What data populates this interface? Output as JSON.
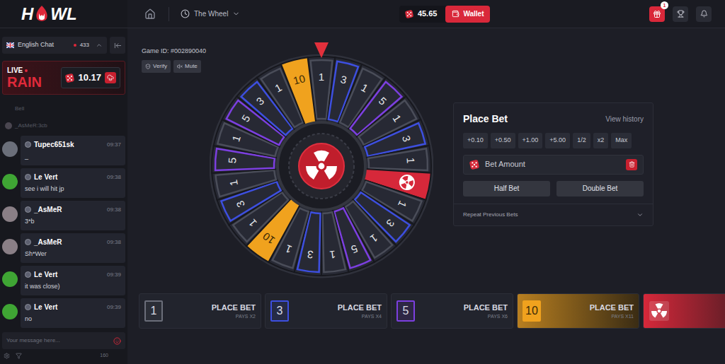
{
  "header": {
    "logo": {
      "left": "H",
      "right": "WL"
    },
    "game_menu": "The Wheel",
    "balance": "45.65",
    "wallet_button": "Wallet",
    "gift_badge": "1"
  },
  "chat": {
    "room": "English Chat",
    "online": "433",
    "rain": {
      "live": "LIVE",
      "title": "RAIN",
      "amount": "10.17"
    },
    "faded": [
      "Bell",
      "_AsMeR:3cb"
    ],
    "messages": [
      {
        "user": "Tupec651sk",
        "time": "09:37",
        "text": "_",
        "color": "#6b6f7a"
      },
      {
        "user": "Le Vert",
        "time": "09:38",
        "text": "see i will hit jp",
        "color": "#3fa534"
      },
      {
        "user": "_AsMeR",
        "time": "09:38",
        "text": "3*b",
        "color": "#8a7f86"
      },
      {
        "user": "_AsMeR",
        "time": "09:38",
        "text": "Sh*Wer",
        "color": "#8a7f86"
      },
      {
        "user": "Le Vert",
        "time": "09:39",
        "text": "it was close)",
        "color": "#3fa534"
      },
      {
        "user": "Le Vert",
        "time": "09:39",
        "text": "no",
        "color": "#3fa534"
      }
    ],
    "input_placeholder": "Your message here...",
    "footer_count": "160"
  },
  "game": {
    "id_label": "Game ID: #002890040",
    "buttons": [
      "Verify",
      "Mute"
    ],
    "segments": [
      {
        "label": "1",
        "kind": "outline",
        "color": "#4a4d59"
      },
      {
        "label": "3",
        "kind": "outline",
        "color": "#3d4fe0"
      },
      {
        "label": "1",
        "kind": "outline",
        "color": "#4a4d59"
      },
      {
        "label": "5",
        "kind": "outline",
        "color": "#7c3fe0"
      },
      {
        "label": "1",
        "kind": "outline",
        "color": "#4a4d59"
      },
      {
        "label": "3",
        "kind": "outline",
        "color": "#3d4fe0"
      },
      {
        "label": "1",
        "kind": "outline",
        "color": "#4a4d59"
      },
      {
        "kind": "jackpot",
        "color": "#d6283a"
      },
      {
        "label": "1",
        "kind": "outline",
        "color": "#4a4d59"
      },
      {
        "label": "3",
        "kind": "outline",
        "color": "#3d4fe0"
      },
      {
        "label": "1",
        "kind": "outline",
        "color": "#4a4d59"
      },
      {
        "label": "5",
        "kind": "outline",
        "color": "#7c3fe0"
      },
      {
        "label": "1",
        "kind": "outline",
        "color": "#4a4d59"
      },
      {
        "label": "3",
        "kind": "outline",
        "color": "#3d4fe0"
      },
      {
        "label": "1",
        "kind": "outline",
        "color": "#4a4d59"
      },
      {
        "label": "10",
        "kind": "solid",
        "color": "#f0a21e"
      },
      {
        "label": "1",
        "kind": "outline",
        "color": "#4a4d59"
      },
      {
        "label": "3",
        "kind": "outline",
        "color": "#3d4fe0"
      },
      {
        "label": "1",
        "kind": "outline",
        "color": "#4a4d59"
      },
      {
        "label": "5",
        "kind": "outline",
        "color": "#7c3fe0"
      },
      {
        "label": "1",
        "kind": "outline",
        "color": "#4a4d59"
      },
      {
        "label": "5",
        "kind": "outline",
        "color": "#7c3fe0"
      },
      {
        "label": "3",
        "kind": "outline",
        "color": "#3d4fe0"
      },
      {
        "label": "1",
        "kind": "outline",
        "color": "#4a4d59"
      },
      {
        "label": "10",
        "kind": "solid",
        "color": "#f0a21e"
      }
    ]
  },
  "bet_panel": {
    "title": "Place Bet",
    "history_link": "View history",
    "quick_amounts": [
      "+0.10",
      "+0.50",
      "+1.00",
      "+5.00",
      "1/2",
      "x2",
      "Max"
    ],
    "amount_placeholder": "Bet Amount",
    "half_button": "Half Bet",
    "double_button": "Double Bet",
    "repeat_label": "Repeat Previous Bets"
  },
  "bet_options": [
    {
      "label": "1",
      "action": "PLACE BET",
      "payout": "PAYS X2",
      "kind": "outline",
      "color": "#6b6e7a"
    },
    {
      "label": "3",
      "action": "PLACE BET",
      "payout": "PAYS X4",
      "kind": "outline",
      "color": "#3d4fe0"
    },
    {
      "label": "5",
      "action": "PLACE BET",
      "payout": "PAYS X6",
      "kind": "outline",
      "color": "#7c3fe0"
    },
    {
      "label": "10",
      "action": "PLACE BET",
      "payout": "PAYS X11",
      "kind": "solid",
      "color": "#f0a21e"
    },
    {
      "kind": "jackpot",
      "color": "#d6283a"
    }
  ]
}
